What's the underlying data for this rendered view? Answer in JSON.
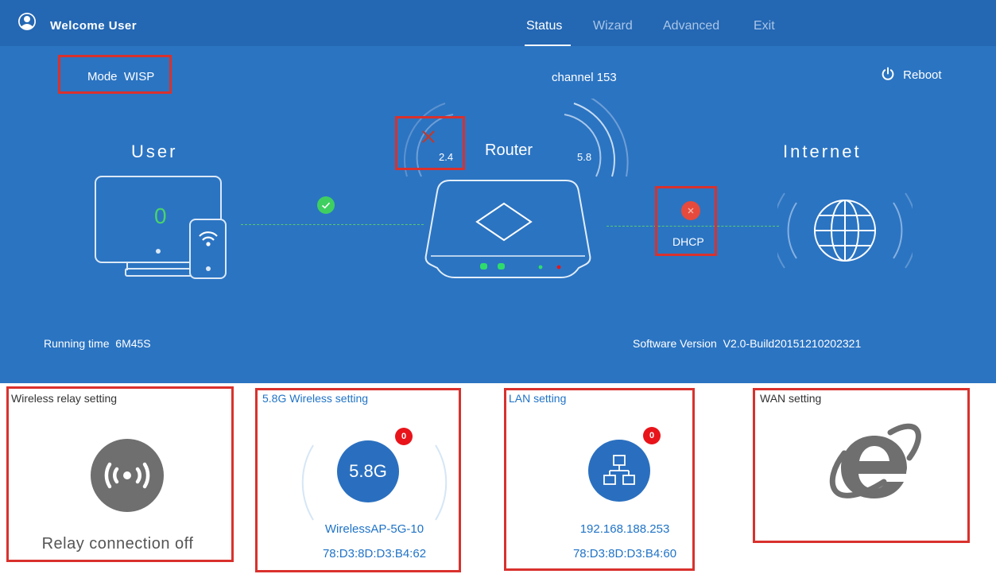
{
  "header": {
    "welcome": "Welcome User",
    "nav": [
      "Status",
      "Wizard",
      "Advanced",
      "Exit"
    ],
    "active_nav": "Status"
  },
  "status": {
    "mode_label": "Mode",
    "mode_value": "WISP",
    "channel_label": "channel",
    "channel_value": "153",
    "reboot_label": "Reboot",
    "user_label": "User",
    "router_label": "Router",
    "internet_label": "Internet",
    "band_24": "2.4",
    "band_58": "5.8",
    "user_count": "0",
    "wan_protocol": "DHCP",
    "running_time_label": "Running time",
    "running_time_value": "6M45S",
    "software_version_label": "Software Version",
    "software_version_value": "V2.0-Build20151210202321"
  },
  "cards": {
    "relay": {
      "title": "Wireless relay setting",
      "status": "Relay connection off"
    },
    "wireless58": {
      "title": "5.8G Wireless setting",
      "band": "5.8G",
      "badge": "0",
      "ssid": "WirelessAP-5G-10",
      "mac": "78:D3:8D:D3:B4:62"
    },
    "lan": {
      "title": "LAN setting",
      "badge": "0",
      "ip": "192.168.188.253",
      "mac": "78:D3:8D:D3:B4:60"
    },
    "wan": {
      "title": "WAN setting"
    }
  },
  "colors": {
    "topbar": "#2467b3",
    "panel": "#2b74c2",
    "highlight_box": "#d9312d",
    "badge": "#e8141a",
    "ok_green": "#3fcf61",
    "error_red": "#e64a3c",
    "card_link_blue": "#1f73c7",
    "icon_grey": "#6f6f6f"
  }
}
